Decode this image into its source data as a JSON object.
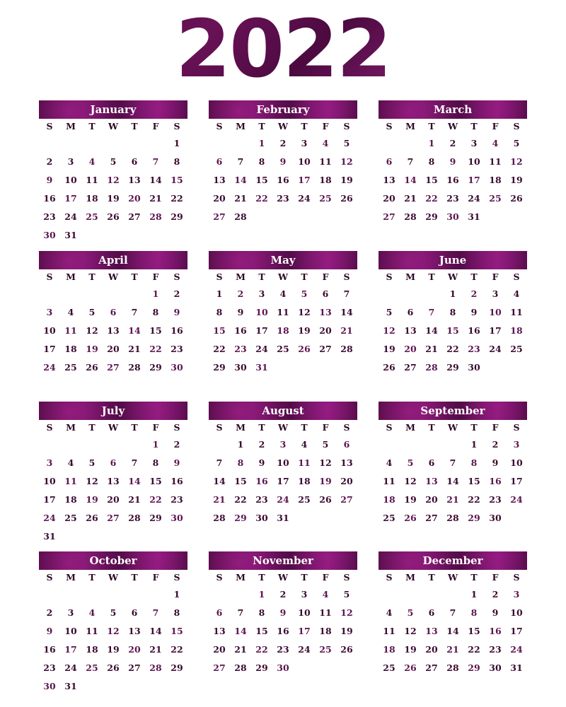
{
  "year": "2022",
  "weekdays": [
    "S",
    "M",
    "T",
    "W",
    "T",
    "F",
    "S"
  ],
  "months": [
    {
      "name": "January",
      "start": 6,
      "days": 31
    },
    {
      "name": "February",
      "start": 2,
      "days": 28
    },
    {
      "name": "March",
      "start": 2,
      "days": 31
    },
    {
      "name": "April",
      "start": 5,
      "days": 30
    },
    {
      "name": "May",
      "start": 0,
      "days": 31
    },
    {
      "name": "June",
      "start": 3,
      "days": 30
    },
    {
      "name": "July",
      "start": 5,
      "days": 31
    },
    {
      "name": "August",
      "start": 1,
      "days": 31
    },
    {
      "name": "September",
      "start": 4,
      "days": 30
    },
    {
      "name": "October",
      "start": 6,
      "days": 31
    },
    {
      "name": "November",
      "start": 2,
      "days": 30
    },
    {
      "name": "December",
      "start": 4,
      "days": 31
    }
  ],
  "colors": {
    "accent": "#5a0c4c",
    "text": "#3a0a30",
    "header_text": "#ffffff"
  }
}
